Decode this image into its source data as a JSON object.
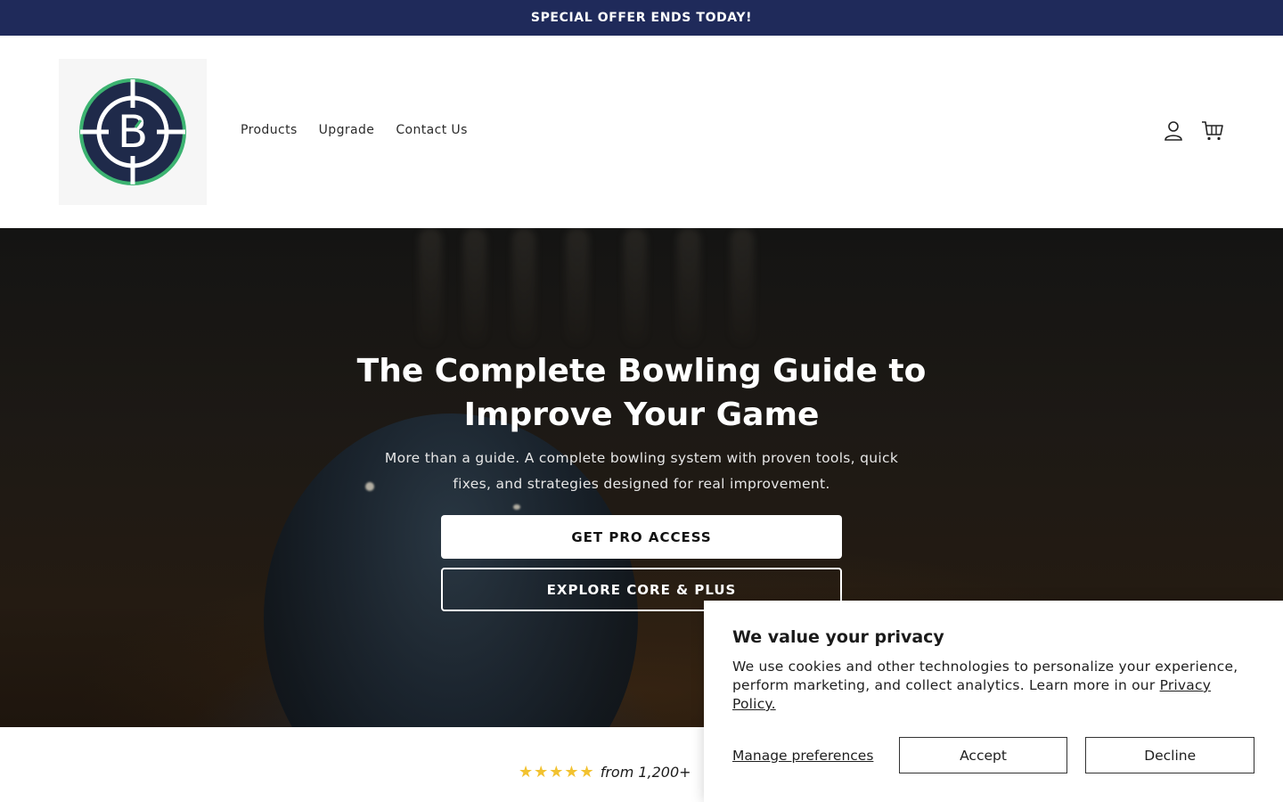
{
  "announcement": {
    "text": "SPECIAL OFFER ENDS TODAY!"
  },
  "header": {
    "logo_letter": "B",
    "nav": [
      {
        "label": "Products"
      },
      {
        "label": "Upgrade"
      },
      {
        "label": "Contact Us"
      }
    ],
    "icons": {
      "account": "user-icon",
      "cart": "cart-icon"
    }
  },
  "hero": {
    "title": "The Complete Bowling Guide to Improve Your Game",
    "subtitle": "More than a guide. A complete bowling system with proven tools, quick fixes, and strategies designed for real improvement.",
    "primary_cta": "GET PRO ACCESS",
    "secondary_cta": "EXPLORE CORE & PLUS"
  },
  "reviews": {
    "stars": "★★★★★",
    "text": "from 1,200+"
  },
  "cookie": {
    "title": "We value your privacy",
    "text": "We use cookies and other technologies to personalize your experience, perform marketing, and collect analytics. Learn more in our",
    "link": "Privacy Policy.",
    "manage": "Manage preferences",
    "accept": "Accept",
    "decline": "Decline"
  },
  "colors": {
    "announcement_bg": "#1f2a5a",
    "logo_navy": "#1f2a4a",
    "logo_green": "#3cb371"
  }
}
